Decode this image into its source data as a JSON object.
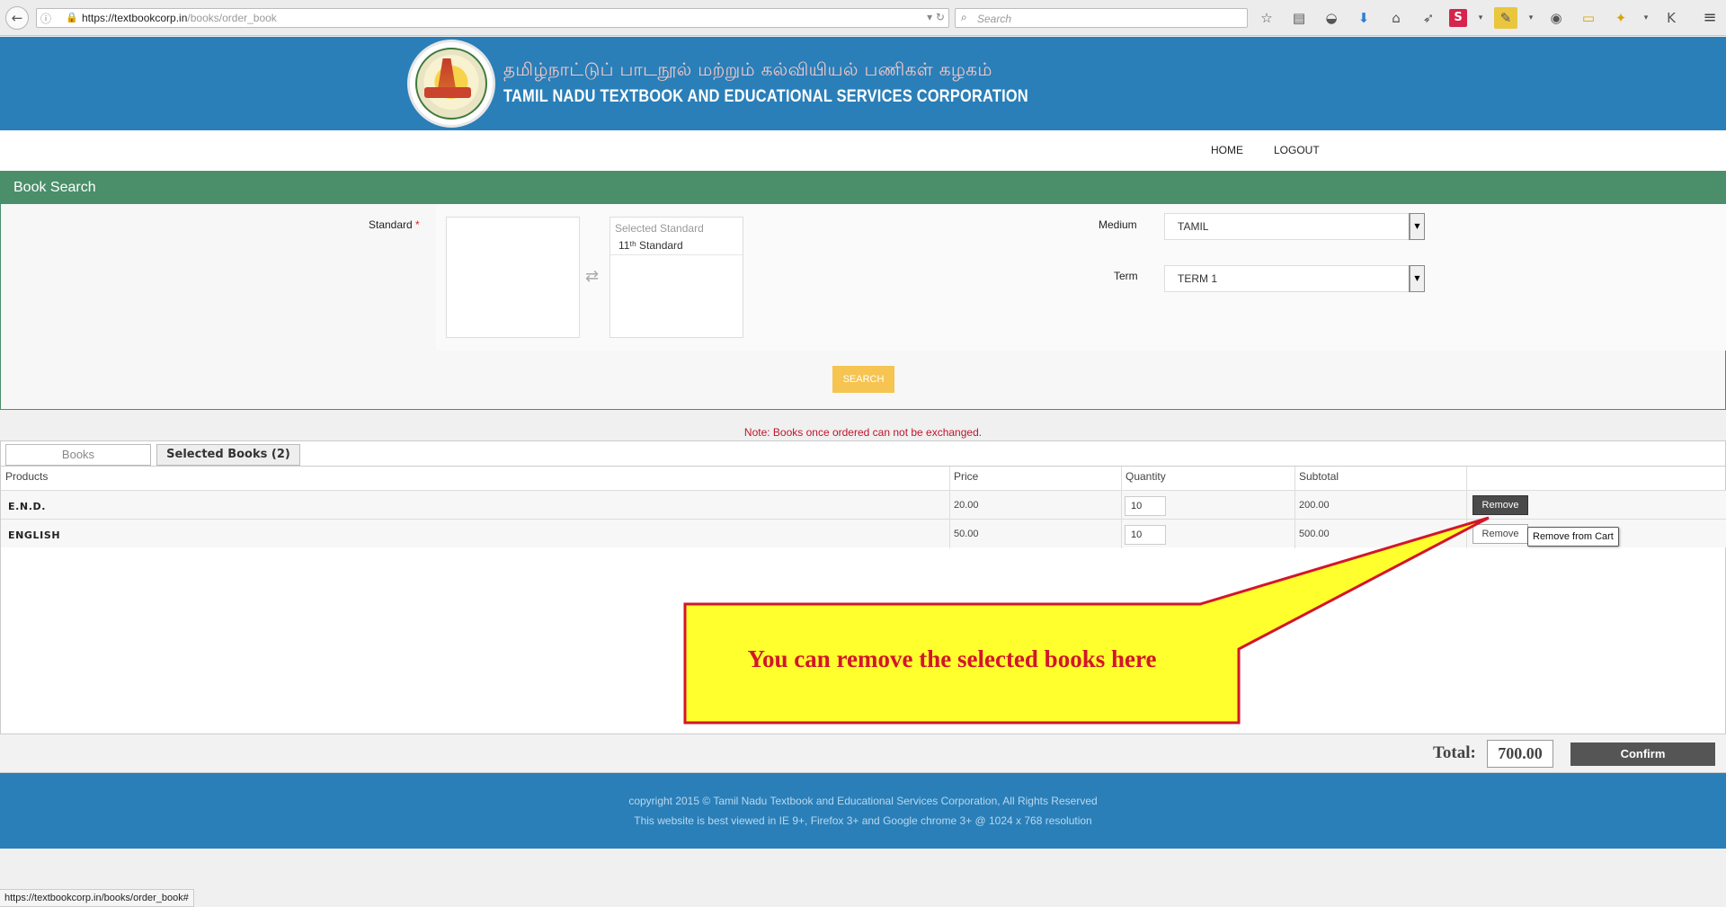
{
  "browser": {
    "url_host": "https://textbookcorp.in",
    "url_path": "/books/order_book",
    "search_placeholder": "Search",
    "status_url": "https://textbookcorp.in/books/order_book#"
  },
  "header": {
    "org_tamil": "தமிழ்நாட்டுப் பாடநூல் மற்றும் கல்வியியல் பணிகள் கழகம்",
    "org_english": "TAMIL NADU TEXTBOOK AND EDUCATIONAL SERVICES CORPORATION"
  },
  "nav": {
    "home": "HOME",
    "logout": "LOGOUT"
  },
  "book_search": {
    "title": "Book Search",
    "standard_label": "Standard",
    "required_mark": "*",
    "selected_caption": "Selected Standard",
    "selected_item": "11ᵗʰ Standard",
    "medium_label": "Medium",
    "medium_value": "TAMIL",
    "term_label": "Term",
    "term_value": "TERM 1",
    "search_button": "SEARCH"
  },
  "note": "Note: Books once ordered can not be exchanged.",
  "tabs": {
    "books": "Books",
    "selected": "Selected Books (2)"
  },
  "table": {
    "headers": [
      "Products",
      "Price",
      "Quantity",
      "Subtotal"
    ],
    "rows": [
      {
        "product": "E.N.D.",
        "price": "20.00",
        "quantity": "10",
        "subtotal": "200.00",
        "action": "Remove"
      },
      {
        "product": "ENGLISH",
        "price": "50.00",
        "quantity": "10",
        "subtotal": "500.00",
        "action": "Remove"
      }
    ]
  },
  "tooltip": "Remove from Cart",
  "callout": "You can remove the selected books here",
  "totals": {
    "label": "Total:",
    "value": "700.00",
    "confirm": "Confirm"
  },
  "footer": {
    "line1": "copyright 2015 © Tamil Nadu Textbook and Educational Services Corporation, All Rights Reserved",
    "line2": "This website is best viewed in IE 9+, Firefox 3+ and Google chrome 3+ @ 1024 x 768 resolution"
  },
  "colors": {
    "header_blue": "#2a7fb8",
    "panel_green": "#4a8f6a",
    "search_orange": "#f5c451",
    "callout_yellow": "#ffff2e",
    "callout_red": "#d2162a"
  }
}
